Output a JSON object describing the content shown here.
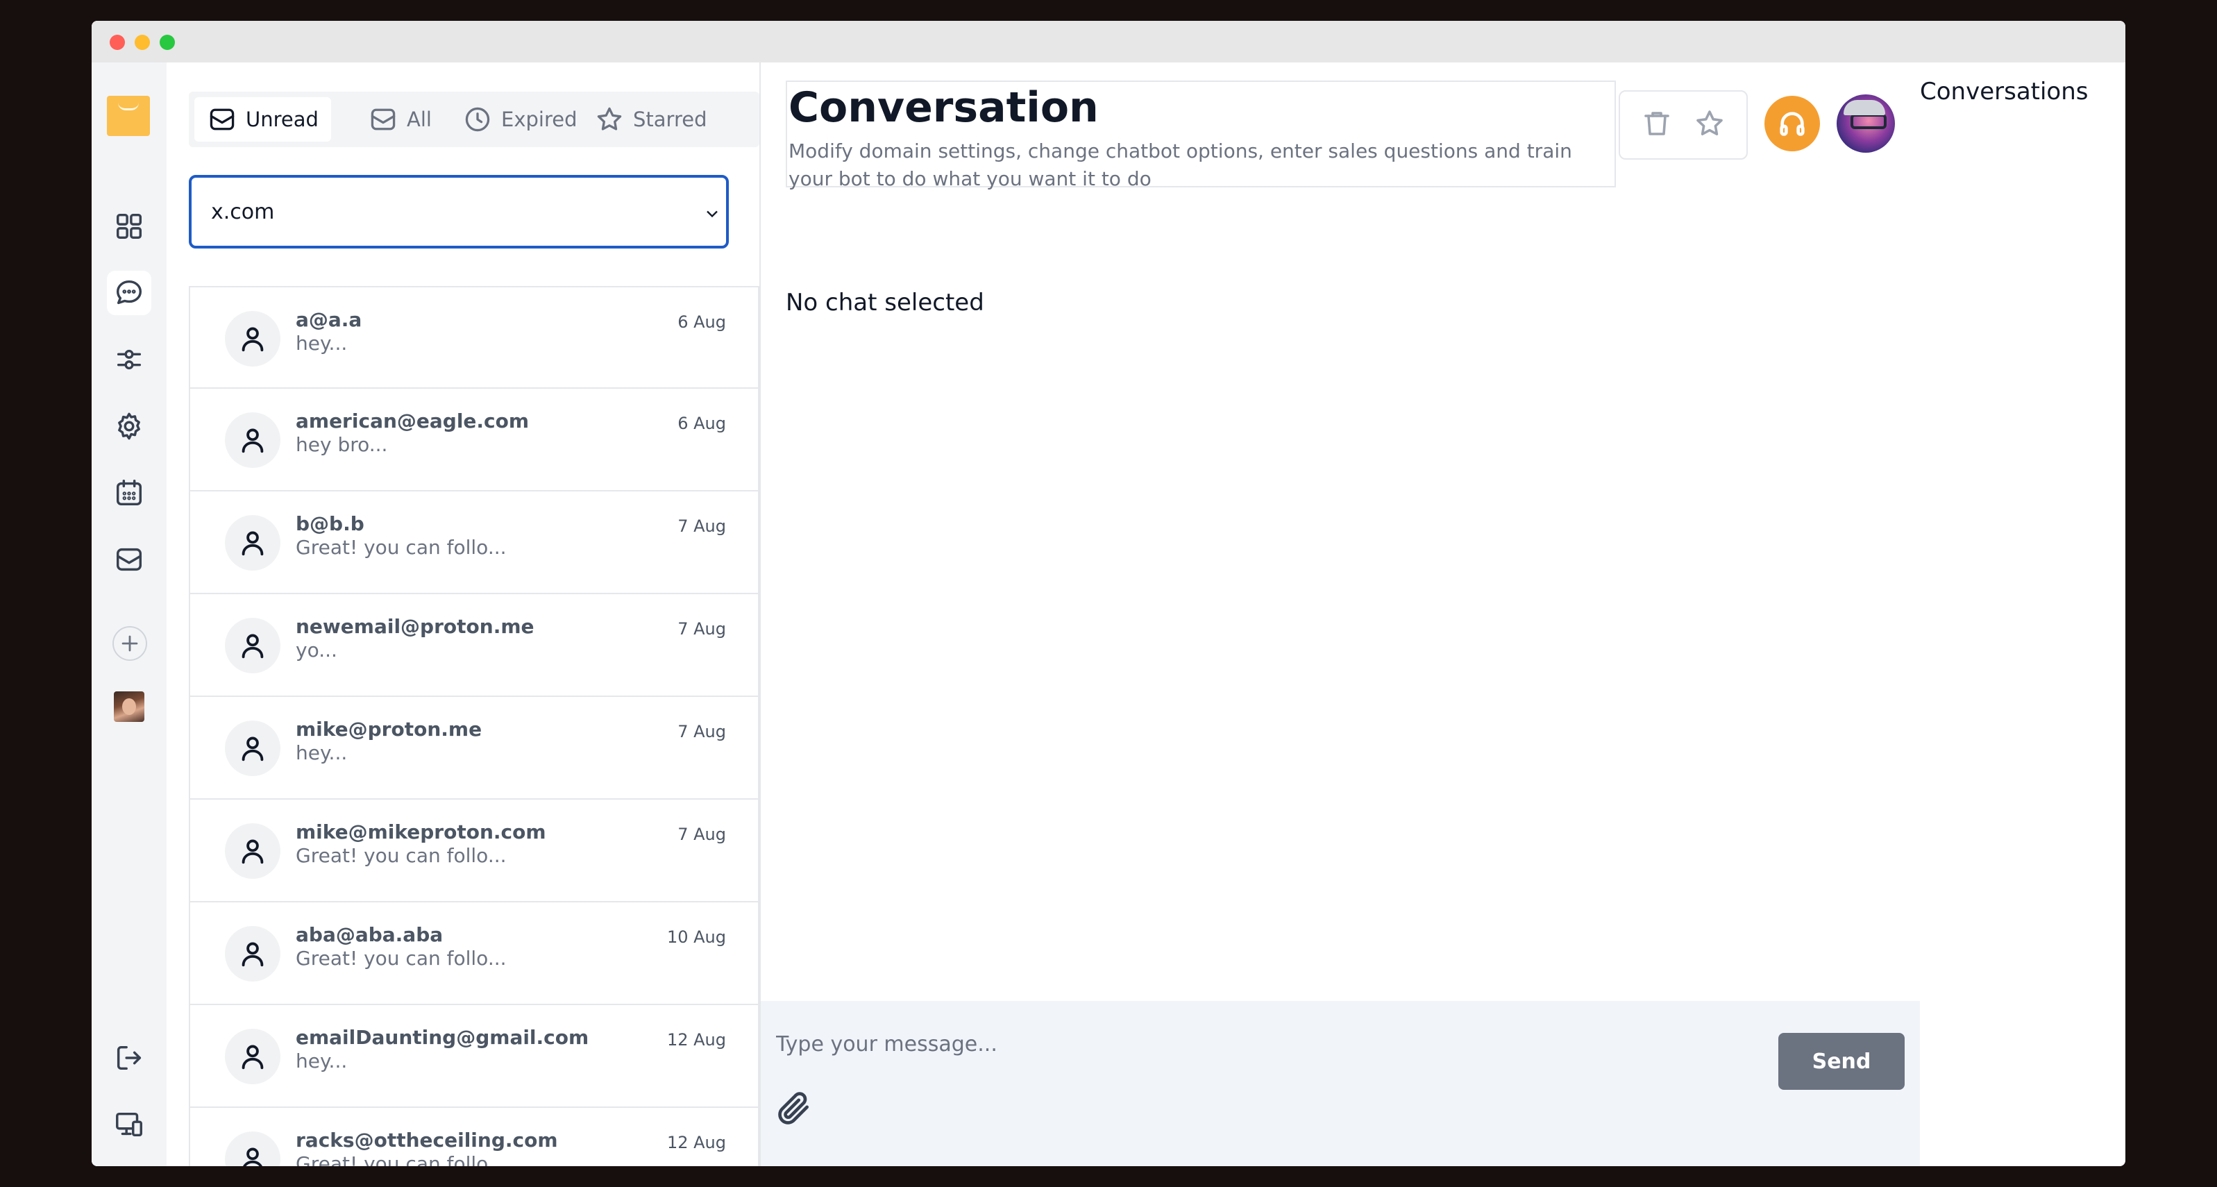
{
  "tabs": [
    {
      "label": "Unread",
      "icon": "mail-icon",
      "active": true
    },
    {
      "label": "All",
      "icon": "mail-icon",
      "active": false
    },
    {
      "label": "Expired",
      "icon": "clock-icon",
      "active": false
    },
    {
      "label": "Starred",
      "icon": "star-icon",
      "active": false
    }
  ],
  "domain_select": {
    "value": "x.com"
  },
  "conversations": [
    {
      "email": "a@a.a",
      "snippet": "hey...",
      "date": "6 Aug"
    },
    {
      "email": "american@eagle.com",
      "snippet": "hey bro...",
      "date": "6 Aug"
    },
    {
      "email": "b@b.b",
      "snippet": "Great! you can follo...",
      "date": "7 Aug"
    },
    {
      "email": "newemail@proton.me",
      "snippet": "yo...",
      "date": "7 Aug"
    },
    {
      "email": "mike@proton.me",
      "snippet": "hey...",
      "date": "7 Aug"
    },
    {
      "email": "mike@mikeproton.com",
      "snippet": "Great! you can follo...",
      "date": "7 Aug"
    },
    {
      "email": "aba@aba.aba",
      "snippet": "Great! you can follo...",
      "date": "10 Aug"
    },
    {
      "email": "emailDaunting@gmail.com",
      "snippet": "hey...",
      "date": "12 Aug"
    },
    {
      "email": "racks@ottheceiling.com",
      "snippet": "Great! you can follo...",
      "date": "12 Aug"
    }
  ],
  "header": {
    "title": "Conversation",
    "subtitle": "Modify domain settings, change chatbot options, enter sales questions and train your bot to do what you want it to do"
  },
  "main": {
    "empty_message": "No chat selected"
  },
  "composer": {
    "placeholder": "Type your message...",
    "send_label": "Send"
  },
  "right_panel": {
    "title": "Conversations"
  },
  "colors": {
    "accent": "#f59e30",
    "select_border": "#1e5bc6",
    "send_button": "#6b7280",
    "composer_bg": "#f1f4f9"
  }
}
